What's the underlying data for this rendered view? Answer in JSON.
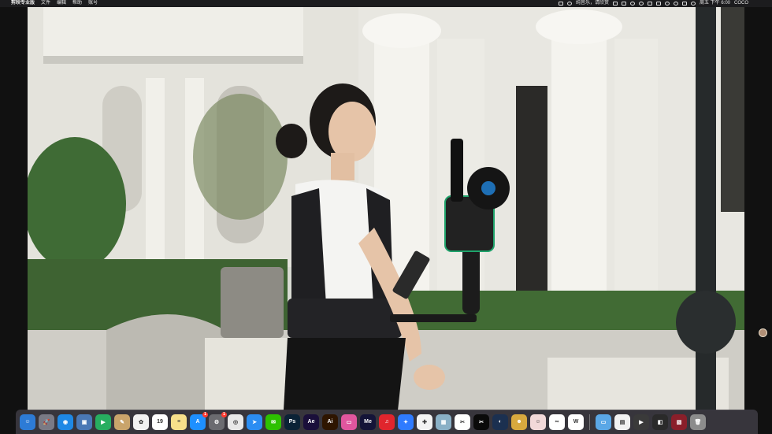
{
  "menubar": {
    "app_name": "剪映专业版",
    "menus": [
      "文件",
      "编辑",
      "帮助",
      "账号"
    ],
    "now_playing": "纯音乐，请欣赏",
    "datetime": "周五 下午 6:00",
    "user": "COCO"
  },
  "player": {
    "scene": "woman-walking-with-gimbal-vest-photo"
  },
  "dock": {
    "items": [
      {
        "name": "finder-icon",
        "glyph": "☺",
        "color": "#2d7bd6"
      },
      {
        "name": "launchpad-icon",
        "glyph": "🚀",
        "color": "#7a7a85"
      },
      {
        "name": "safari-icon",
        "glyph": "◉",
        "color": "#1e88e5"
      },
      {
        "name": "preview-icon",
        "glyph": "▣",
        "color": "#4a78b5"
      },
      {
        "name": "facetime-icon",
        "glyph": "▶",
        "color": "#27ae60"
      },
      {
        "name": "notes-app-icon",
        "glyph": "✎",
        "color": "#c9a46b"
      },
      {
        "name": "photos-icon",
        "glyph": "✿",
        "color": "#f1f1f1"
      },
      {
        "name": "calendar-icon",
        "glyph": "19",
        "color": "#ffffff"
      },
      {
        "name": "notes-icon",
        "glyph": "≡",
        "color": "#f7e08a"
      },
      {
        "name": "app-store-icon",
        "glyph": "A",
        "color": "#1e90ff",
        "badge": "1"
      },
      {
        "name": "system-settings-icon",
        "glyph": "⚙",
        "color": "#6b6b70",
        "badge": "1"
      },
      {
        "name": "chrome-icon",
        "glyph": "◎",
        "color": "#e8e8e8"
      },
      {
        "name": "direct-share-icon",
        "glyph": "➤",
        "color": "#2b8df2"
      },
      {
        "name": "wechat-icon",
        "glyph": "✉",
        "color": "#2dc100"
      },
      {
        "name": "photoshop-icon",
        "glyph": "Ps",
        "color": "#0b2236"
      },
      {
        "name": "after-effects-icon",
        "glyph": "Ae",
        "color": "#1a0f3a"
      },
      {
        "name": "illustrator-icon",
        "glyph": "Ai",
        "color": "#2e1500"
      },
      {
        "name": "folder-pink-icon",
        "glyph": "▭",
        "color": "#e0569e"
      },
      {
        "name": "media-encoder-icon",
        "glyph": "Me",
        "color": "#141438"
      },
      {
        "name": "netease-music-icon",
        "glyph": "♫",
        "color": "#e0252d"
      },
      {
        "name": "lark-icon",
        "glyph": "✦",
        "color": "#2f7bff"
      },
      {
        "name": "xiaohongshu-icon",
        "glyph": "✚",
        "color": "#f3f3f3"
      },
      {
        "name": "screenshot-icon",
        "glyph": "▦",
        "color": "#8ab0c6"
      },
      {
        "name": "capcut-icon",
        "glyph": "✂",
        "color": "#ffffff"
      },
      {
        "name": "jianying-icon",
        "glyph": "✂",
        "color": "#0a0a0a"
      },
      {
        "name": "cinema-4d-icon",
        "glyph": "◐",
        "color": "#1b3050"
      },
      {
        "name": "doge-icon",
        "glyph": "☻",
        "color": "#d8a93e"
      },
      {
        "name": "avatar-app-icon",
        "glyph": "☺",
        "color": "#f2d9d9"
      },
      {
        "name": "baidu-netdisk-icon",
        "glyph": "∞",
        "color": "#ffffff"
      },
      {
        "name": "wps-icon",
        "glyph": "W",
        "color": "#ffffff"
      }
    ],
    "right_items": [
      {
        "name": "folder-icon",
        "glyph": "▭",
        "color": "#5aa7e6"
      },
      {
        "name": "document-thumbnail-icon",
        "glyph": "▤",
        "color": "#f2f2f2"
      },
      {
        "name": "video-thumbnail-icon",
        "glyph": "▶",
        "color": "#3a3a3a"
      },
      {
        "name": "screen-recording-thumbnail-icon",
        "glyph": "◧",
        "color": "#2a2a2a"
      },
      {
        "name": "image-thumbnail-icon",
        "glyph": "▧",
        "color": "#8a1f2a"
      },
      {
        "name": "trash-icon",
        "glyph": "🗑",
        "color": "#8c8c8c"
      }
    ]
  }
}
